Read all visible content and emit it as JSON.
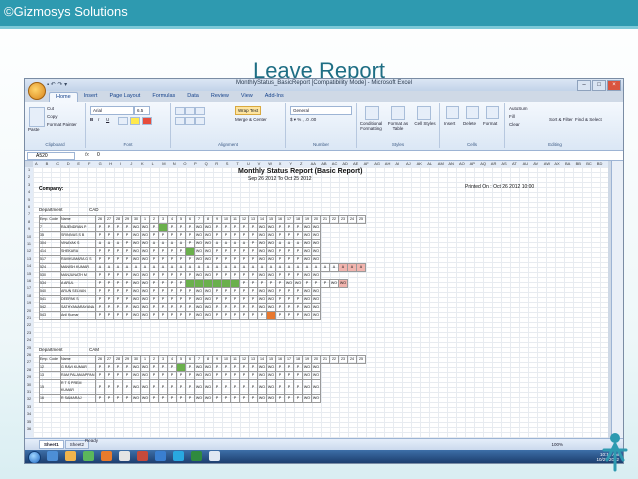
{
  "slide": {
    "copyright": "©Gizmosys Solutions",
    "title": "Leave Report",
    "colors": {
      "band": "#2e9ab0",
      "title": "#1e6e84"
    }
  },
  "window": {
    "title": "MonthlyStatus_BasicReport [Compatibility Mode] - Microsoft Excel",
    "tabs": [
      "Home",
      "Insert",
      "Page Layout",
      "Formulas",
      "Data",
      "Review",
      "View",
      "Add-Ins"
    ],
    "active_tab": "Home"
  },
  "ribbon": {
    "clipboard": {
      "paste": "Paste",
      "cut": "Cut",
      "copy": "Copy",
      "format_painter": "Format Painter",
      "label": "Clipboard"
    },
    "font": {
      "name": "Arial",
      "size": "6.5",
      "label": "Font"
    },
    "alignment": {
      "wrap_text": "Wrap Text",
      "merge": "Merge & Center",
      "label": "Alignment"
    },
    "number": {
      "format": "General",
      "label": "Number"
    },
    "styles": {
      "conditional": "Conditional Formatting",
      "format_table": "Format as Table",
      "cell_styles": "Cell Styles",
      "label": "Styles"
    },
    "cells": {
      "insert": "Insert",
      "delete": "Delete",
      "format": "Format",
      "label": "Cells"
    },
    "editing": {
      "autosum": "AutoSum",
      "fill": "Fill",
      "clear": "Clear",
      "sort": "Sort & Filter",
      "find": "Find & Select",
      "label": "Editing"
    }
  },
  "formula_bar": {
    "cell": "A520",
    "fx": "fx",
    "value": "0"
  },
  "columns": [
    "A",
    "B",
    "C",
    "D",
    "E",
    "F",
    "G",
    "H",
    "I",
    "J",
    "K",
    "L",
    "M",
    "N",
    "O",
    "P",
    "Q",
    "R",
    "S",
    "T",
    "U",
    "V",
    "W",
    "X",
    "Y",
    "Z",
    "AA",
    "AB",
    "AC",
    "AD",
    "AE",
    "AF",
    "AG",
    "AH",
    "AI",
    "AJ",
    "AK",
    "AL",
    "AM",
    "AN",
    "AO",
    "AP",
    "AQ",
    "AR",
    "AS",
    "AT",
    "AU",
    "AV",
    "AW",
    "AX",
    "BA",
    "BB",
    "BC",
    "BD"
  ],
  "report": {
    "title": "Monthly Status Report (Basic Report)",
    "dates": "Sep 26 2012  To  Oct 25 2012",
    "company": "Company:",
    "printed": "Printed On : Oct 26 2012 10:00"
  },
  "sections": [
    {
      "department": "Department",
      "dept_name": "CAD",
      "emp_code_label": "Emp. Code",
      "name_label": "Name",
      "rows": [
        {
          "code": "7",
          "name": "RAJENDRAN P",
          "marks": "PPPPWOWOPGPPPWOWOPPPPPWOWOPPPWOWO"
        },
        {
          "code": "35",
          "name": "SRINIVAS S B",
          "marks": "PPPPWOWOPPPPPWOWOPPPPPWOWOPPPWOWO"
        },
        {
          "code": "304",
          "name": "VINAYAK S",
          "marks": "AAAPWOWOAAAAPWOWOAAAAPWOWOAAAWOWO"
        },
        {
          "code": "414",
          "name": "SHEKARA",
          "marks": "PPPPWOWOPPPPGWOWOPPPPPWOWOPPPWOWO"
        },
        {
          "code": "517",
          "name": "RAVIKUMARA G S",
          "marks": "PPPPWOWOPPPPPWOWOPPPPPWOWOPPPWOWO"
        },
        {
          "code": "524",
          "name": "MANISH KUMAR",
          "marks": "AAAAAAAAAAAAAAAAAAAAAAAAAAAAAAAA"
        },
        {
          "code": "530",
          "name": "MANJUNATH M",
          "marks": "PPPPWOWOPPPPPWOWOPPPPPWOWOPPPWOWO"
        },
        {
          "code": "534",
          "name": "A ARUL",
          "marks": "PPPPWOWOPPPPGGGGGGPPPPPWOWOPPPWOWO"
        },
        {
          "code": "540",
          "name": "ARUN SELVAN",
          "marks": "PPPPWOWOPPPPPWOWOPPPPPWOWOPPPWOWO"
        },
        {
          "code": "541",
          "name": "DEEPAK S",
          "marks": "PPPPWOWOPPPPPWOWOPPPPPWOWOPPPWOWO"
        },
        {
          "code": "542",
          "name": "SATHYANARAYANA",
          "marks": "PPPPWOWOPPPPPWOWOPPPPPWOWOPPPWOWO"
        },
        {
          "code": "543",
          "name": "Anil Kumar",
          "marks": "PPPPWOWOPPPPPWOWOPPPPPPOPPPWOWO"
        }
      ]
    },
    {
      "department": "Department",
      "dept_name": "CAM",
      "emp_code_label": "Emp. Code",
      "name_label": "Name",
      "rows": [
        {
          "code": "12",
          "name": "G RAVI KUMAR",
          "marks": "PPPPWOWOPPPGPWOWOPPPPPWOWOPPPWOWO"
        },
        {
          "code": "13",
          "name": "RAM PALANIAPPAN",
          "marks": "PPPPWOWOPPPPPWOWOPPPPPWOWOPPPWOWO"
        },
        {
          "code": "15",
          "name": "R T S PREM KUMAR",
          "marks": "PPPPWOWOPPPPPWOWOPPPPPWOWOPPPWOWO"
        },
        {
          "code": "16",
          "name": "R SAMARAJ",
          "marks": "PPPPWOWOPPPPPWOWOPPPPPWOWOPPPWOWO"
        }
      ]
    }
  ],
  "status": {
    "ready": "Ready",
    "sheet_tabs": [
      "Sheet1",
      "Sheet2"
    ],
    "zoom": "100%"
  },
  "taskbar": {
    "time": "10:14 AM",
    "date": "10/26/2012"
  }
}
